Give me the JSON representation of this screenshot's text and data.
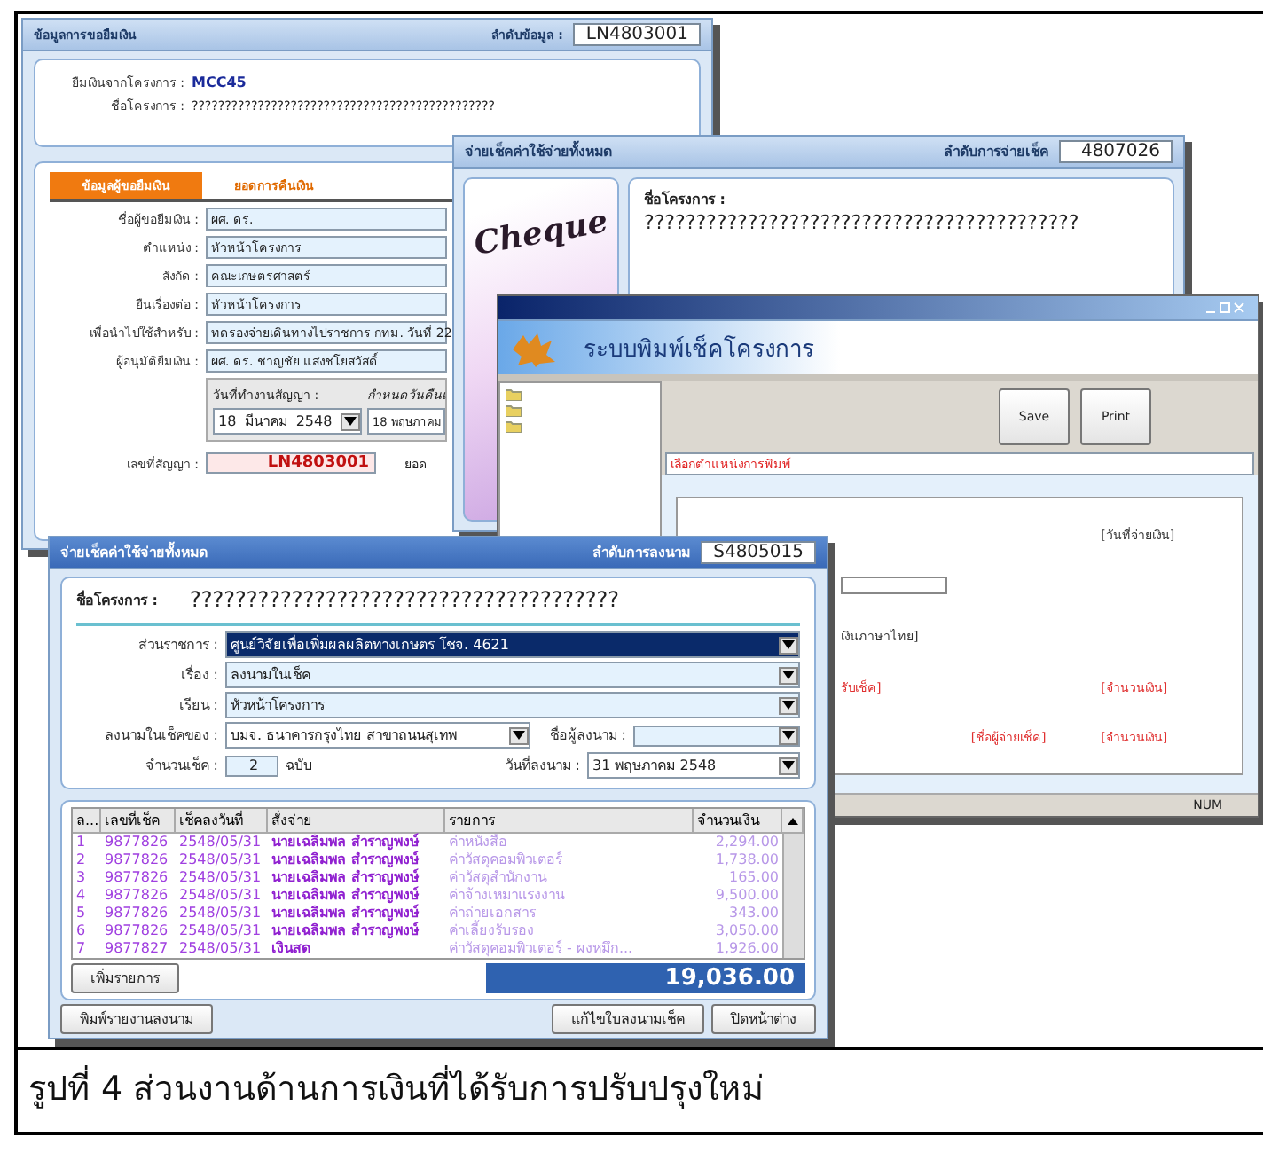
{
  "loan_window": {
    "title": "ข้อมูลการขอยืมเงิน",
    "record_label": "ลำดับข้อมูล :",
    "record_no": "LN4803001",
    "project_code_label": "ยืมเงินจากโครงการ :",
    "project_code": "MCC45",
    "project_name_label": "ชื่อโครงการ :",
    "project_name": "??????????????????????????????????????????????",
    "tabs": [
      {
        "label": "ข้อมูลผู้ขอยืมเงิน",
        "selected": true
      },
      {
        "label": "ยอดการคืนเงิน",
        "selected": false
      }
    ],
    "fields": [
      {
        "label": "ชื่อผู้ขอยืมเงิน :",
        "value": "ผศ. ดร."
      },
      {
        "label": "ตำแหน่ง :",
        "value": "หัวหน้าโครงการ"
      },
      {
        "label": "สังกัด :",
        "value": "คณะเกษตรศาสตร์"
      },
      {
        "label": "ยืนเรื่องต่อ :",
        "value": "หัวหน้าโครงการ"
      },
      {
        "label": "เพื่อนำไปใช้สำหรับ :",
        "value": "ทดรองจ่ายเดินทางไปราชการ กทม. วันที่ 22"
      },
      {
        "label": "ผู้อนุมัติยืมเงิน :",
        "value": "ผศ. ดร. ชาญชัย แสงชโยสวัสดิ์"
      }
    ],
    "contract_date_label": "วันที่ทำงานสัญญา :",
    "contract_date": [
      "18",
      "มีนาคม",
      "2548"
    ],
    "due_date_label": "กำหนดวันคืนเ",
    "due_date": "18 พฤษภาคม",
    "contract_no_label": "เลขที่สัญญา :",
    "contract_no": "LN4803001",
    "amount_label": "ยอด"
  },
  "cheque_window": {
    "title": "จ่ายเช็คค่าใช้จ่ายทั้งหมด",
    "record_label": "ลำดับการจ่ายเช็ค",
    "record_no": "4807026",
    "logo": "Cheque",
    "project_name_label": "ชื่อโครงการ :",
    "project_name": "??????????????????????????????????????????"
  },
  "print_window": {
    "heading": "ระบบพิมพ์เช็คโครงการ",
    "buttons": [
      "Save",
      "Print"
    ],
    "position_field": "เลือกตำแหน่งการพิมพ์",
    "placeholders": [
      {
        "kind": "black",
        "text": "[วันที่จ่ายเงิน]"
      },
      {
        "kind": "black",
        "text": "เงินภาษาไทย]"
      },
      {
        "kind": "red",
        "text": "รับเช็ค]"
      },
      {
        "kind": "red",
        "text": "[จำนวนเงิน]"
      },
      {
        "kind": "red",
        "text": "[ชื่อผู้จ่ายเช็ค]"
      },
      {
        "kind": "red",
        "text": "[จำนวนเงิน]"
      }
    ],
    "status": "NUM"
  },
  "sign_window": {
    "title": "จ่ายเช็คค่าใช้จ่ายทั้งหมด",
    "record_label": "ลำดับการลงนาม",
    "record_no": "S4805015",
    "project_name_label": "ชื่อโครงการ :",
    "project_name": "??????????????????????????????????????",
    "selects": [
      {
        "label": "ส่วนราชการ :",
        "value": "ศูนย์วิจัยเพื่อเพิ่มผลผลิตทางเกษตร โชจ. 4621",
        "selected": true
      },
      {
        "label": "เรื่อง :",
        "value": "ลงนามในเช็ค",
        "selected": false
      },
      {
        "label": "เรียน :",
        "value": "หัวหน้าโครงการ",
        "selected": false
      }
    ],
    "bank_label": "ลงนามในเช็คของ :",
    "bank": "บมจ. ธนาคารกรุงไทย สาขาถนนสุเทพ",
    "signer_label": "ชื่อผู้ลงนาม :",
    "count_label": "จำนวนเช็ค :",
    "count": "2",
    "count_unit": "ฉบับ",
    "date_label": "วันที่ลงนาม :",
    "date": "31 พฤษภาคม 2548",
    "columns": [
      "ล...",
      "เลขที่เช็ค",
      "เช็คลงวันที่",
      "สั่งจ่าย",
      "รายการ",
      "จำนวนเงิน"
    ],
    "rows": [
      [
        "1",
        "9877826",
        "2548/05/31",
        "นายเฉลิมพล สำราญพงษ์",
        "ค่าหนังสือ",
        "2,294.00"
      ],
      [
        "2",
        "9877826",
        "2548/05/31",
        "นายเฉลิมพล สำราญพงษ์",
        "ค่าวัสดุคอมพิวเตอร์",
        "1,738.00"
      ],
      [
        "3",
        "9877826",
        "2548/05/31",
        "นายเฉลิมพล สำราญพงษ์",
        "ค่าวัสดุสำนักงาน",
        "165.00"
      ],
      [
        "4",
        "9877826",
        "2548/05/31",
        "นายเฉลิมพล สำราญพงษ์",
        "ค่าจ้างเหมาแรงงาน",
        "9,500.00"
      ],
      [
        "5",
        "9877826",
        "2548/05/31",
        "นายเฉลิมพล สำราญพงษ์",
        "ค่าถ่ายเอกสาร",
        "343.00"
      ],
      [
        "6",
        "9877826",
        "2548/05/31",
        "นายเฉลิมพล สำราญพงษ์",
        "ค่าเลี้ยงรับรอง",
        "3,050.00"
      ],
      [
        "7",
        "9877827",
        "2548/05/31",
        "เงินสด",
        "ค่าวัสดุคอมพิวเตอร์ - ผงหมึก...",
        "1,926.00"
      ]
    ],
    "add_button": "เพิ่มรายการ",
    "total": "19,036.00",
    "buttons": [
      "พิมพ์รายงานลงนาม",
      "แก้ไขใบลงนามเช็ค",
      "ปิดหน้าต่าง"
    ]
  },
  "caption": "รูปที่ 4 ส่วนงานด้านการเงินที่ได้รับการปรับปรุงใหม่"
}
